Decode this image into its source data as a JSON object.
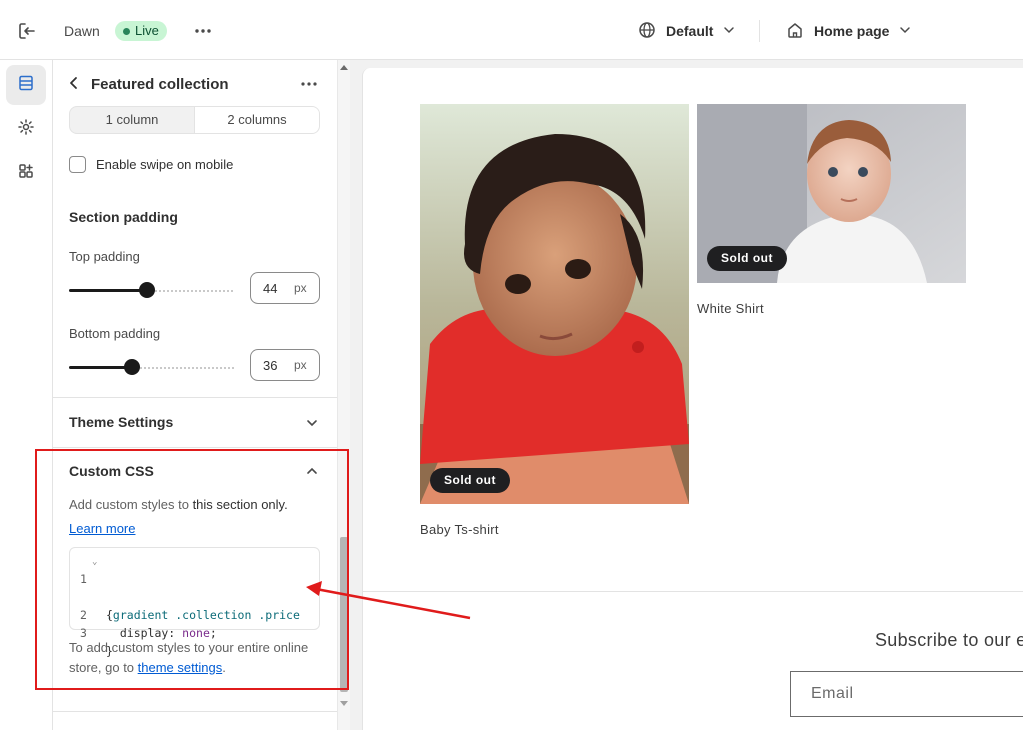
{
  "topbar": {
    "theme_name": "Dawn",
    "status_badge": "Live",
    "template_selector": "Default",
    "page_selector": "Home page"
  },
  "panel": {
    "title": "Featured collection",
    "columns_options": [
      "1 column",
      "2 columns"
    ],
    "columns_selected": "2 columns",
    "swipe_label": "Enable swipe on mobile",
    "swipe_checked": false,
    "section_padding_title": "Section padding",
    "top_padding": {
      "label": "Top padding",
      "value": "44",
      "unit": "px",
      "fraction": 0.47
    },
    "bottom_padding": {
      "label": "Bottom padding",
      "value": "36",
      "unit": "px",
      "fraction": 0.38
    },
    "theme_settings_title": "Theme Settings",
    "custom_css": {
      "title": "Custom CSS",
      "help_prefix": "Add custom styles to ",
      "help_emphasis": "this section only.",
      "learn_more": "Learn more",
      "code_lines": [
        {
          "num": "1",
          "tokens": [
            ".gradient",
            " ",
            ".collection",
            " ",
            ".price"
          ]
        },
        {
          "num": "",
          "tokens": [
            "{"
          ]
        },
        {
          "num": "2",
          "tokens": [
            "  display: ",
            "none",
            ";"
          ]
        },
        {
          "num": "3",
          "tokens": [
            "}"
          ]
        }
      ],
      "footer_prefix": "To add custom styles to your entire online store, go to ",
      "footer_link": "theme settings",
      "footer_suffix": "."
    }
  },
  "preview": {
    "products": [
      {
        "title": "Baby Ts-shirt",
        "badge": "Sold out"
      },
      {
        "title": "White Shirt",
        "badge": "Sold out"
      }
    ],
    "subscribe_heading": "Subscribe to our em",
    "email_placeholder": "Email"
  },
  "colors": {
    "live_badge_bg": "#c8f5d4",
    "link": "#005bd3",
    "highlight": "#e01b1b",
    "badge_bg": "#1f1f21"
  }
}
